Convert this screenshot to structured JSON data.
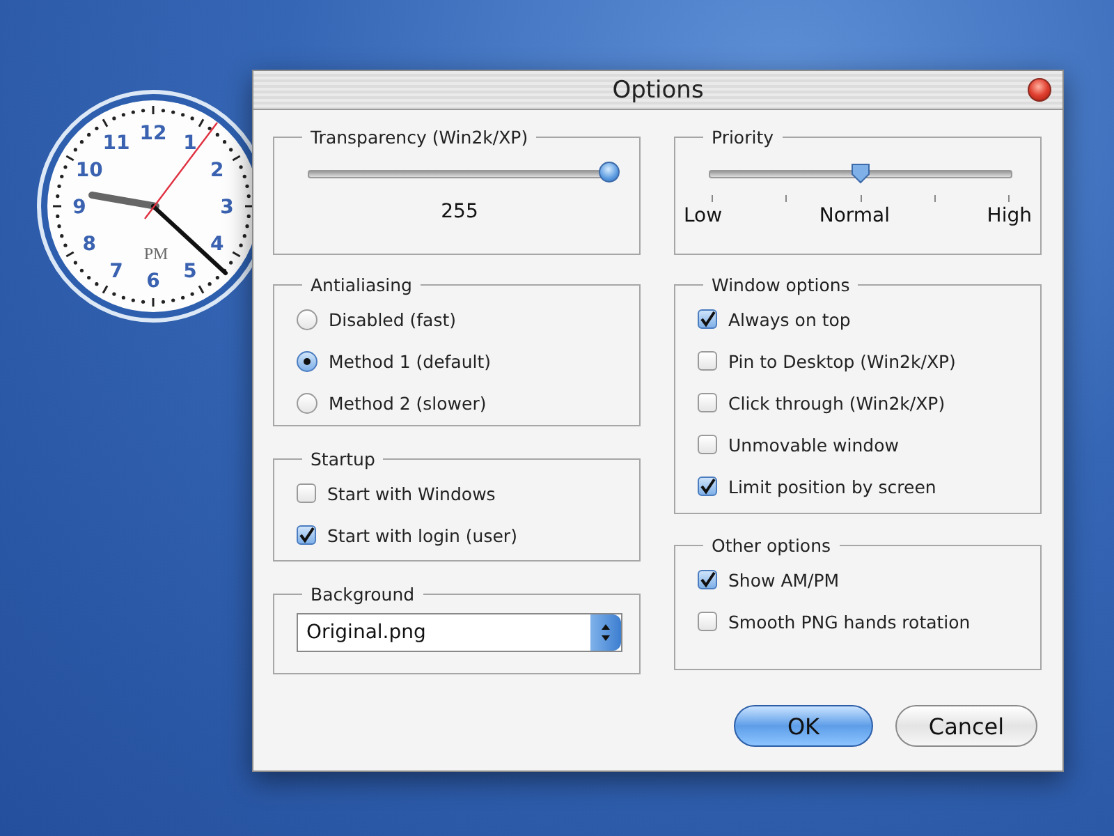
{
  "desktop": {
    "clock": {
      "numerals": [
        "12",
        "1",
        "2",
        "3",
        "4",
        "5",
        "6",
        "7",
        "8",
        "9",
        "10",
        "11"
      ],
      "label": "PM"
    }
  },
  "window": {
    "title": "Options"
  },
  "transparency": {
    "title": "Transparency (Win2k/XP)",
    "level": 1,
    "reading": "255"
  },
  "antialiasing": {
    "title": "Antialiasing",
    "options": [
      {
        "label": "Disabled (fast)",
        "selected": false
      },
      {
        "label": "Method 1 (default)",
        "selected": true
      },
      {
        "label": "Method 2 (slower)",
        "selected": false
      }
    ]
  },
  "startup": {
    "title": "Startup",
    "options": [
      {
        "label": "Start with Windows",
        "checked": false
      },
      {
        "label": "Start with login (user)",
        "checked": true
      }
    ]
  },
  "background": {
    "title": "Background",
    "value": "Original.png"
  },
  "priority": {
    "title": "Priority",
    "level": 0.5,
    "labels": [
      "Low",
      "Normal",
      "High"
    ]
  },
  "window_options": {
    "title": "Window options",
    "options": [
      {
        "label": "Always on top",
        "checked": true
      },
      {
        "label": "Pin to Desktop (Win2k/XP)",
        "checked": false
      },
      {
        "label": "Click through (Win2k/XP)",
        "checked": false
      },
      {
        "label": "Unmovable window",
        "checked": false
      },
      {
        "label": "Limit position by screen",
        "checked": true
      }
    ]
  },
  "other_options": {
    "title": "Other options",
    "options": [
      {
        "label": "Show AM/PM",
        "checked": true
      },
      {
        "label": "Smooth PNG hands rotation",
        "checked": false
      }
    ]
  },
  "buttons": [
    {
      "label": "OK",
      "default": true
    },
    {
      "label": "Cancel",
      "default": false
    }
  ]
}
